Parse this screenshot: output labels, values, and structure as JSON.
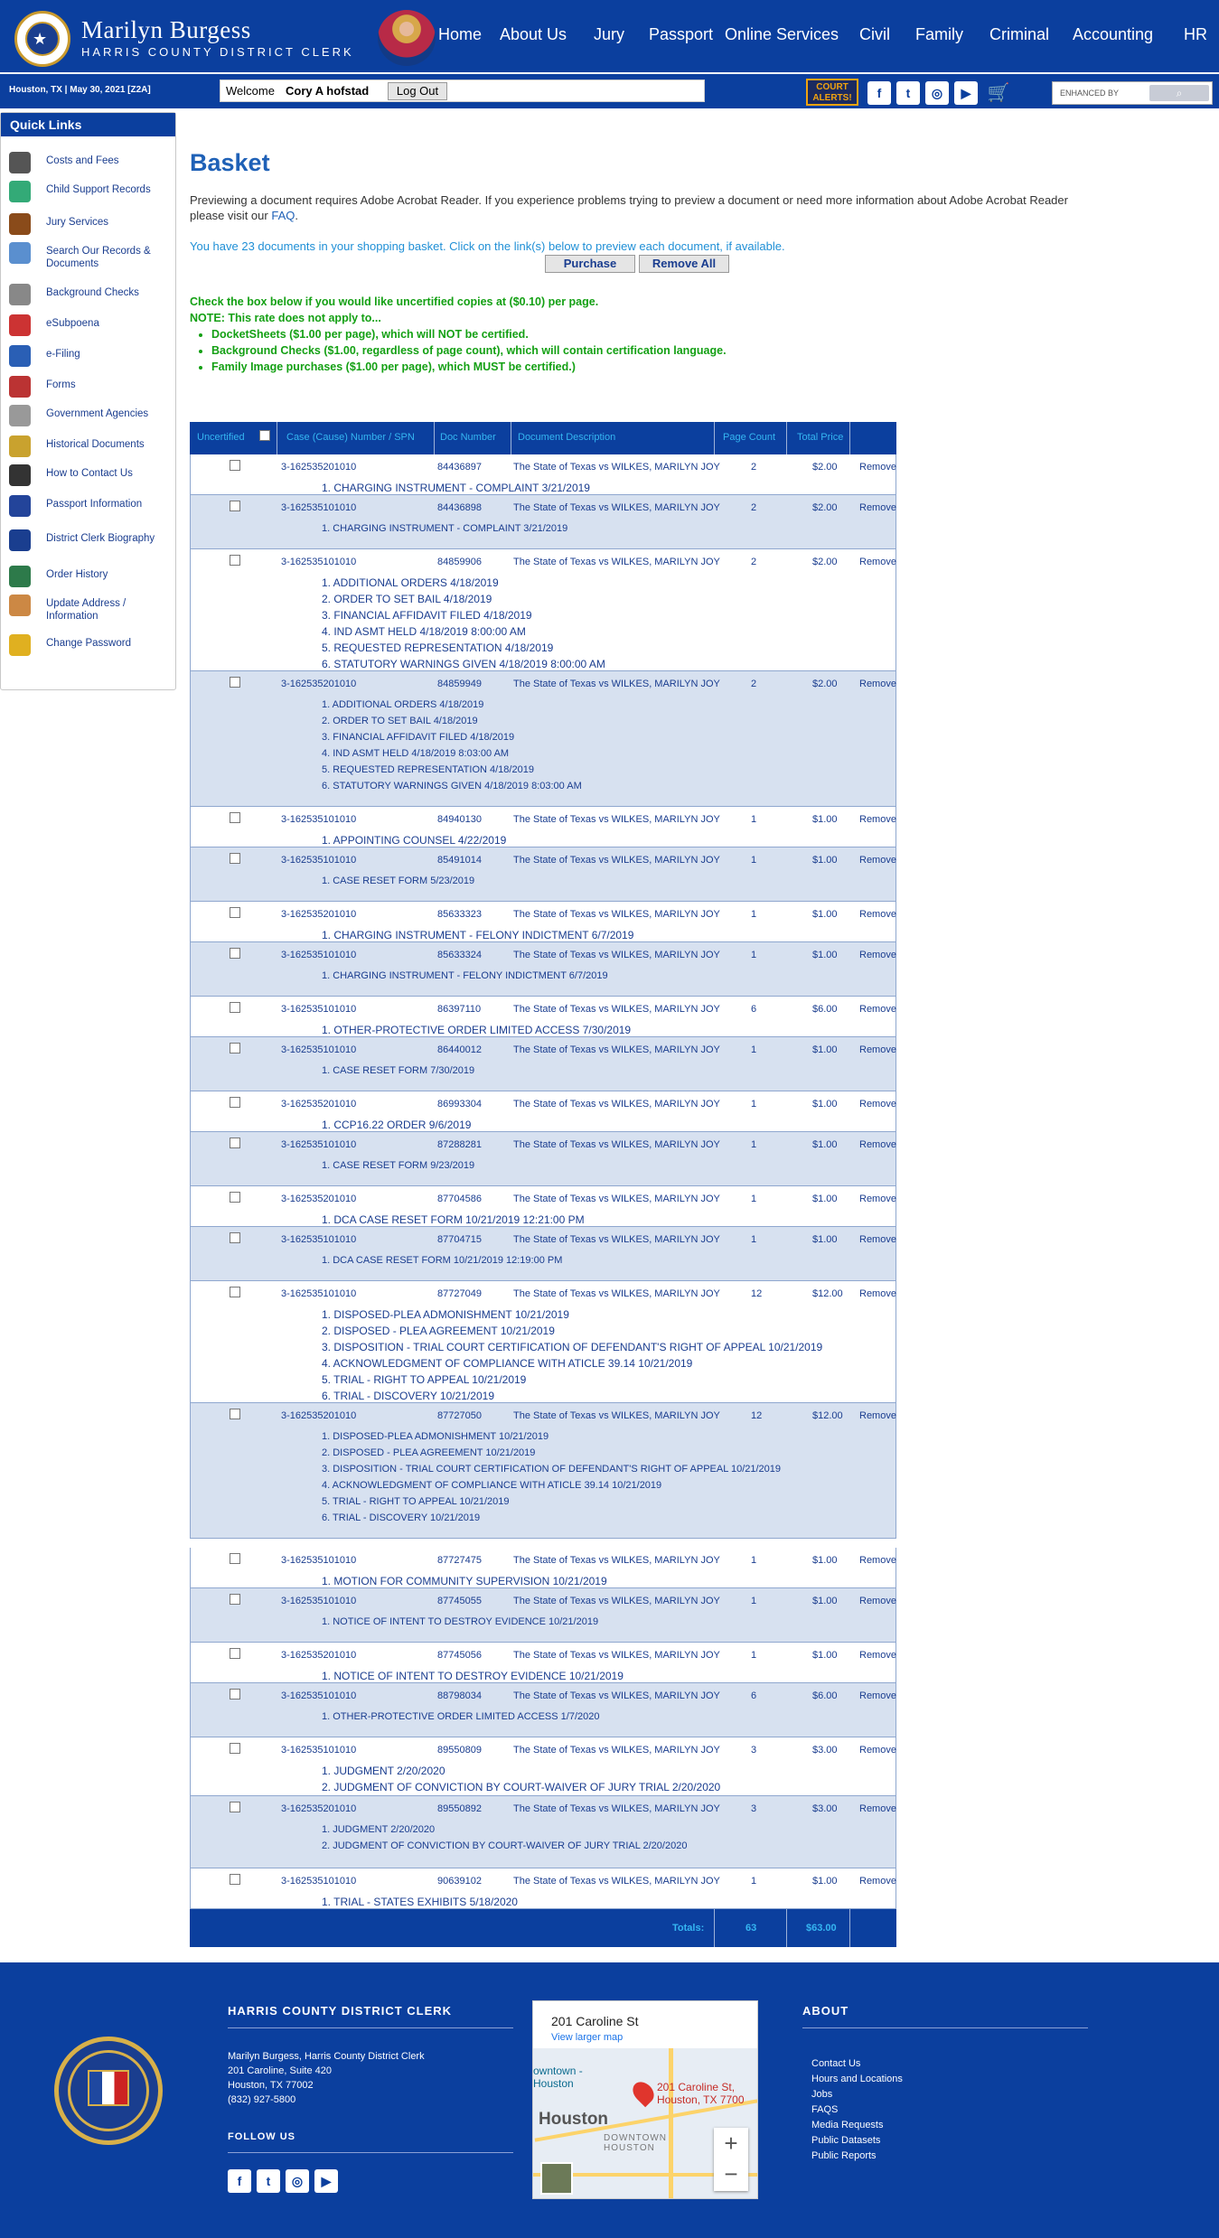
{
  "header": {
    "name": "Marilyn Burgess",
    "subtitle": "HARRIS COUNTY DISTRICT CLERK",
    "nav": [
      "Home",
      "About Us",
      "Jury",
      "Passport",
      "Online Services",
      "Civil",
      "Family",
      "Criminal",
      "Accounting",
      "HR"
    ]
  },
  "subbar": {
    "date": "Houston, TX | May 30, 2021 [Z2A]",
    "welcome": "Welcome",
    "user": "Cory A hofstad",
    "logout": "Log Out",
    "alerts": "COURT ALERTS!",
    "search_placeholder": "ENHANCED BY"
  },
  "quick_links": {
    "title": "Quick Links",
    "items": [
      "Costs and Fees",
      "Child Support Records",
      "Jury Services",
      "Search Our Records & Documents",
      "Background Checks",
      "eSubpoena",
      "e-Filing",
      "Forms",
      "Government Agencies",
      "Historical Documents",
      "How to Contact Us",
      "Passport Information",
      "District Clerk Biography",
      "Order History",
      "Update Address / Information",
      "Change Password"
    ]
  },
  "basket": {
    "title": "Basket",
    "intro": "Previewing a document requires Adobe Acrobat Reader. If you experience problems trying to preview a document or need more information about Adobe Acrobat Reader please visit our",
    "faq": "FAQ",
    "count_text": "You have 23 documents in your shopping basket. Click on the link(s) below to preview each document, if available.",
    "purchase": "Purchase",
    "remove_all": "Remove All",
    "note1": "Check the box below if you would like uncertified copies at ($0.10) per page.",
    "note2": "NOTE: This rate does not apply to...",
    "bullets": [
      "DocketSheets ($1.00 per page), which will NOT be certified.",
      "Background Checks ($1.00, regardless of page count), which will contain certification language.",
      "Family Image purchases ($1.00 per page), which MUST be certified.)"
    ]
  },
  "table": {
    "headers": [
      "Uncertified",
      "Case (Cause) Number / SPN",
      "Doc Number",
      "Document Description",
      "Page Count",
      "Total Price"
    ],
    "remove_label": "Remove",
    "rows": [
      {
        "case": "3-162535201010",
        "doc": "84436897",
        "desc": "The State of Texas vs WILKES, MARILYN JOY",
        "pages": "2",
        "price": "$2.00",
        "lines": [
          "1. CHARGING INSTRUMENT - COMPLAINT 3/21/2019"
        ]
      },
      {
        "case": "3-162535101010",
        "doc": "84436898",
        "desc": "The State of Texas vs WILKES, MARILYN JOY",
        "pages": "2",
        "price": "$2.00",
        "lines": [
          "1. CHARGING INSTRUMENT - COMPLAINT 3/21/2019"
        ]
      },
      {
        "case": "3-162535101010",
        "doc": "84859906",
        "desc": "The State of Texas vs WILKES, MARILYN JOY",
        "pages": "2",
        "price": "$2.00",
        "lines": [
          "1. ADDITIONAL ORDERS 4/18/2019",
          "2. ORDER TO SET BAIL 4/18/2019",
          "3. FINANCIAL AFFIDAVIT FILED 4/18/2019",
          "4. IND ASMT HELD 4/18/2019 8:00:00 AM",
          "5. REQUESTED REPRESENTATION 4/18/2019",
          "6. STATUTORY WARNINGS GIVEN 4/18/2019 8:00:00 AM"
        ]
      },
      {
        "case": "3-162535201010",
        "doc": "84859949",
        "desc": "The State of Texas vs WILKES, MARILYN JOY",
        "pages": "2",
        "price": "$2.00",
        "lines": [
          "1. ADDITIONAL ORDERS 4/18/2019",
          "2. ORDER TO SET BAIL 4/18/2019",
          "3. FINANCIAL AFFIDAVIT FILED 4/18/2019",
          "4. IND ASMT HELD 4/18/2019 8:03:00 AM",
          "5. REQUESTED REPRESENTATION 4/18/2019",
          "6. STATUTORY WARNINGS GIVEN 4/18/2019 8:03:00 AM"
        ]
      },
      {
        "case": "3-162535101010",
        "doc": "84940130",
        "desc": "The State of Texas vs WILKES, MARILYN JOY",
        "pages": "1",
        "price": "$1.00",
        "lines": [
          "1. APPOINTING COUNSEL 4/22/2019"
        ]
      },
      {
        "case": "3-162535101010",
        "doc": "85491014",
        "desc": "The State of Texas vs WILKES, MARILYN JOY",
        "pages": "1",
        "price": "$1.00",
        "lines": [
          "1. CASE RESET FORM 5/23/2019"
        ]
      },
      {
        "case": "3-162535201010",
        "doc": "85633323",
        "desc": "The State of Texas vs WILKES, MARILYN JOY",
        "pages": "1",
        "price": "$1.00",
        "lines": [
          "1. CHARGING INSTRUMENT - FELONY INDICTMENT 6/7/2019"
        ]
      },
      {
        "case": "3-162535101010",
        "doc": "85633324",
        "desc": "The State of Texas vs WILKES, MARILYN JOY",
        "pages": "1",
        "price": "$1.00",
        "lines": [
          "1. CHARGING INSTRUMENT - FELONY INDICTMENT 6/7/2019"
        ]
      },
      {
        "case": "3-162535101010",
        "doc": "86397110",
        "desc": "The State of Texas vs WILKES, MARILYN JOY",
        "pages": "6",
        "price": "$6.00",
        "lines": [
          "1. OTHER-PROTECTIVE ORDER LIMITED ACCESS 7/30/2019"
        ]
      },
      {
        "case": "3-162535101010",
        "doc": "86440012",
        "desc": "The State of Texas vs WILKES, MARILYN JOY",
        "pages": "1",
        "price": "$1.00",
        "lines": [
          "1. CASE RESET FORM 7/30/2019"
        ]
      },
      {
        "case": "3-162535201010",
        "doc": "86993304",
        "desc": "The State of Texas vs WILKES, MARILYN JOY",
        "pages": "1",
        "price": "$1.00",
        "lines": [
          "1. CCP16.22 ORDER 9/6/2019"
        ]
      },
      {
        "case": "3-162535101010",
        "doc": "87288281",
        "desc": "The State of Texas vs WILKES, MARILYN JOY",
        "pages": "1",
        "price": "$1.00",
        "lines": [
          "1. CASE RESET FORM 9/23/2019"
        ]
      },
      {
        "case": "3-162535201010",
        "doc": "87704586",
        "desc": "The State of Texas vs WILKES, MARILYN JOY",
        "pages": "1",
        "price": "$1.00",
        "lines": [
          "1. DCA CASE RESET FORM 10/21/2019 12:21:00 PM"
        ]
      },
      {
        "case": "3-162535101010",
        "doc": "87704715",
        "desc": "The State of Texas vs WILKES, MARILYN JOY",
        "pages": "1",
        "price": "$1.00",
        "lines": [
          "1. DCA CASE RESET FORM 10/21/2019 12:19:00 PM"
        ]
      },
      {
        "case": "3-162535101010",
        "doc": "87727049",
        "desc": "The State of Texas vs WILKES, MARILYN JOY",
        "pages": "12",
        "price": "$12.00",
        "lines": [
          "1. DISPOSED-PLEA ADMONISHMENT 10/21/2019",
          "2. DISPOSED - PLEA AGREEMENT 10/21/2019",
          "3. DISPOSITION - TRIAL COURT CERTIFICATION OF DEFENDANT'S RIGHT OF APPEAL 10/21/2019",
          "4. ACKNOWLEDGMENT OF COMPLIANCE WITH ATICLE 39.14 10/21/2019",
          "5. TRIAL - RIGHT TO APPEAL 10/21/2019",
          "6. TRIAL - DISCOVERY 10/21/2019"
        ]
      },
      {
        "case": "3-162535201010",
        "doc": "87727050",
        "desc": "The State of Texas vs WILKES, MARILYN JOY",
        "pages": "12",
        "price": "$12.00",
        "lines": [
          "1. DISPOSED-PLEA ADMONISHMENT 10/21/2019",
          "2. DISPOSED - PLEA AGREEMENT 10/21/2019",
          "3. DISPOSITION - TRIAL COURT CERTIFICATION OF DEFENDANT'S RIGHT OF APPEAL 10/21/2019",
          "4. ACKNOWLEDGMENT OF COMPLIANCE WITH ATICLE 39.14 10/21/2019",
          "5. TRIAL - RIGHT TO APPEAL 10/21/2019",
          "6. TRIAL - DISCOVERY 10/21/2019"
        ]
      },
      {
        "case": "3-162535101010",
        "doc": "87727475",
        "desc": "The State of Texas vs WILKES, MARILYN JOY",
        "pages": "1",
        "price": "$1.00",
        "lines": [
          "1. MOTION FOR COMMUNITY SUPERVISION 10/21/2019"
        ]
      },
      {
        "case": "3-162535101010",
        "doc": "87745055",
        "desc": "The State of Texas vs WILKES, MARILYN JOY",
        "pages": "1",
        "price": "$1.00",
        "lines": [
          "1. NOTICE OF INTENT TO DESTROY EVIDENCE 10/21/2019"
        ]
      },
      {
        "case": "3-162535201010",
        "doc": "87745056",
        "desc": "The State of Texas vs WILKES, MARILYN JOY",
        "pages": "1",
        "price": "$1.00",
        "lines": [
          "1. NOTICE OF INTENT TO DESTROY EVIDENCE 10/21/2019"
        ]
      },
      {
        "case": "3-162535101010",
        "doc": "88798034",
        "desc": "The State of Texas vs WILKES, MARILYN JOY",
        "pages": "6",
        "price": "$6.00",
        "lines": [
          "1. OTHER-PROTECTIVE ORDER LIMITED ACCESS 1/7/2020"
        ]
      },
      {
        "case": "3-162535101010",
        "doc": "89550809",
        "desc": "The State of Texas vs WILKES, MARILYN JOY",
        "pages": "3",
        "price": "$3.00",
        "lines": [
          "1. JUDGMENT 2/20/2020",
          "2. JUDGMENT OF CONVICTION BY COURT-WAIVER OF JURY TRIAL 2/20/2020"
        ]
      },
      {
        "case": "3-162535201010",
        "doc": "89550892",
        "desc": "The State of Texas vs WILKES, MARILYN JOY",
        "pages": "3",
        "price": "$3.00",
        "lines": [
          "1. JUDGMENT 2/20/2020",
          "2. JUDGMENT OF CONVICTION BY COURT-WAIVER OF JURY TRIAL 2/20/2020"
        ]
      },
      {
        "case": "3-162535101010",
        "doc": "90639102",
        "desc": "The State of Texas vs WILKES, MARILYN JOY",
        "pages": "1",
        "price": "$1.00",
        "lines": [
          "1. TRIAL - STATES EXHIBITS 5/18/2020"
        ]
      }
    ],
    "totals_label": "Totals:",
    "total_pages": "63",
    "total_price": "$63.00"
  },
  "footer": {
    "heading": "HARRIS COUNTY DISTRICT CLERK",
    "address": [
      "Marilyn Burgess, Harris County District Clerk",
      "201 Caroline, Suite 420",
      "Houston, TX 77002",
      "(832) 927-5800"
    ],
    "follow": "FOLLOW US",
    "map_title": "201 Caroline St",
    "map_link": "View larger map",
    "map_pin": "201 Caroline St, Houston, TX 7700",
    "map_city": "Houston",
    "map_downtown": "DOWNTOWN HOUSTON",
    "map_area": "owntown -Houston",
    "about": "ABOUT",
    "about_links": [
      "Contact Us",
      "Hours and Locations",
      "Jobs",
      "FAQS",
      "Media Requests",
      "Public Datasets",
      "Public Reports"
    ]
  }
}
